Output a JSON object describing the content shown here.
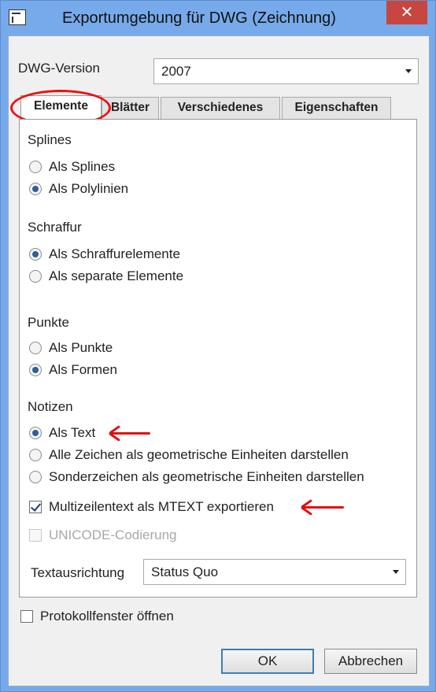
{
  "window": {
    "title": "Exportumgebung für DWG (Zeichnung)",
    "close_glyph": "✕"
  },
  "dwg_version": {
    "label": "DWG-Version",
    "value": "2007"
  },
  "tabs": [
    {
      "label": "Elemente",
      "active": true
    },
    {
      "label": "Blätter",
      "active": false
    },
    {
      "label": "Verschiedenes",
      "active": false
    },
    {
      "label": "Eigenschaften",
      "active": false
    }
  ],
  "sections": {
    "splines": {
      "heading": "Splines",
      "options": [
        {
          "label": "Als Splines",
          "selected": false
        },
        {
          "label": "Als Polylinien",
          "selected": true
        }
      ]
    },
    "schraffur": {
      "heading": "Schraffur",
      "options": [
        {
          "label": "Als Schraffurelemente",
          "selected": true
        },
        {
          "label": "Als separate Elemente",
          "selected": false
        }
      ]
    },
    "punkte": {
      "heading": "Punkte",
      "options": [
        {
          "label": "Als Punkte",
          "selected": false
        },
        {
          "label": "Als Formen",
          "selected": true
        }
      ]
    },
    "notizen": {
      "heading": "Notizen",
      "options": [
        {
          "label": "Als Text",
          "selected": true
        },
        {
          "label": "Alle Zeichen als geometrische Einheiten darstellen",
          "selected": false
        },
        {
          "label": "Sonderzeichen als geometrische Einheiten darstellen",
          "selected": false
        }
      ]
    }
  },
  "checkboxes": {
    "multiline": {
      "label": "Multizeilentext als MTEXT exportieren",
      "checked": true,
      "enabled": true
    },
    "unicode": {
      "label": "UNICODE-Codierung",
      "checked": false,
      "enabled": false
    }
  },
  "text_alignment": {
    "label": "Textausrichtung",
    "value": "Status Quo"
  },
  "log_window": {
    "label": "Protokollfenster öffnen",
    "checked": false
  },
  "buttons": {
    "ok": "OK",
    "cancel": "Abbrechen"
  },
  "colors": {
    "annotation_red": "#e01010",
    "titlebar_blue": "#77aaea",
    "close_red": "#c7463f"
  },
  "icons": {
    "app": "dwg-export-icon",
    "close": "close-icon",
    "dropdown": "chevron-down-icon"
  }
}
